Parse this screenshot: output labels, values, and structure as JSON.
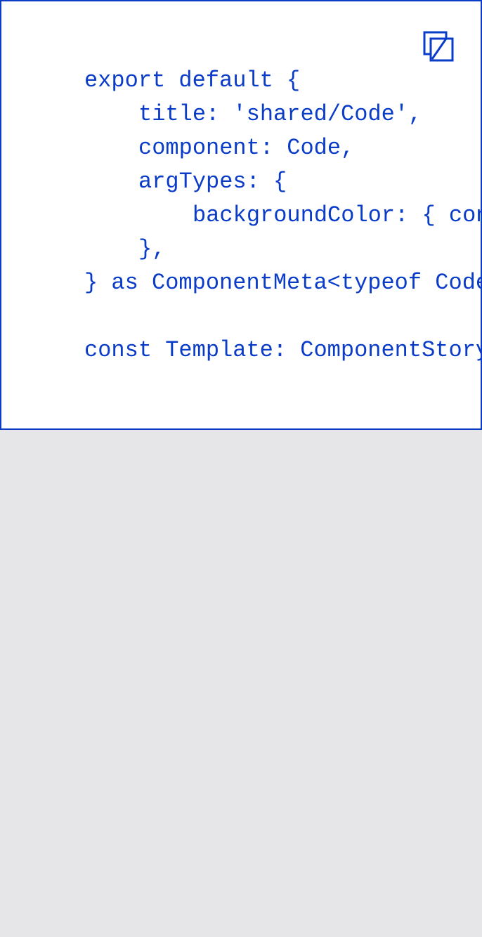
{
  "colors": {
    "accent": "#0a3cc8",
    "panel_background": "#ffffff",
    "page_background": "#e6e6e8"
  },
  "toolbar": {
    "copy_icon": "copy-icon"
  },
  "code": {
    "lines": [
      "export default {",
      "title: 'shared/Code',",
      "component: Code,",
      "argTypes: {",
      "backgroundColor: { con",
      "},",
      "} as ComponentMeta<typeof Code",
      "",
      "const Template: ComponentStory"
    ]
  }
}
